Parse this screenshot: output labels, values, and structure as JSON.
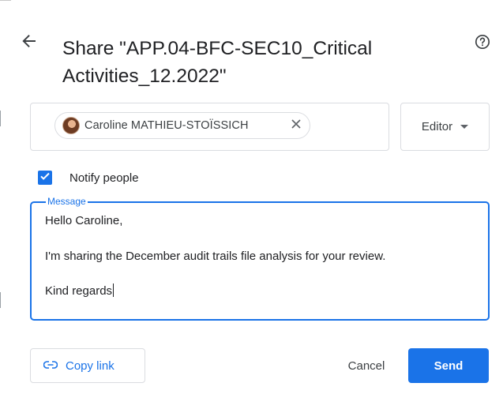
{
  "dialog": {
    "title": "Share \"APP.04-BFC-SEC10_Critical Activities_12.2022\""
  },
  "recipients": [
    {
      "name": "Caroline MATHIEU-STOÏSSICH"
    }
  ],
  "role": {
    "selected": "Editor"
  },
  "notify": {
    "label": "Notify people",
    "checked": true
  },
  "message": {
    "legend": "Message",
    "body": "Hello Caroline,\n\nI'm sharing the December audit trails file analysis for your review.\n\nKind regards"
  },
  "actions": {
    "copy_link": "Copy link",
    "cancel": "Cancel",
    "send": "Send"
  },
  "colors": {
    "accent": "#1a73e8",
    "border": "#dadce0",
    "text": "#202124"
  }
}
